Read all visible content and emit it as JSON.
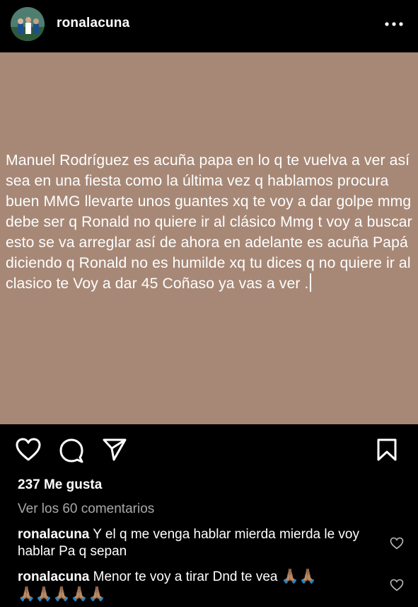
{
  "header": {
    "username": "ronalacuna",
    "more_icon": "ellipsis-icon"
  },
  "post": {
    "background_color": "#a78876",
    "text": "Manuel Rodríguez es acuña papa en lo q te vuelva a ver así sea en una fiesta como la última vez q hablamos procura buen MMG llevarte unos guantes xq te voy a dar golpe mmg debe ser q Ronald no quiere ir al clásico Mmg t voy a buscar esto se va arreglar así de ahora en adelante es acuña Papá diciendo q Ronald no es humilde xq tu dices q no quiere ir al clasico te Voy a dar 45 Coñaso ya vas a ver ."
  },
  "actions": {
    "like_icon": "heart-icon",
    "comment_icon": "comment-icon",
    "share_icon": "send-icon",
    "save_icon": "bookmark-icon"
  },
  "likes": "237 Me gusta",
  "view_comments": "Ver los 60 comentarios",
  "comments": [
    {
      "user": "ronalacuna",
      "text": " Y el q me venga hablar mierda mierda le voy hablar Pa q sepan"
    },
    {
      "user": "ronalacuna",
      "text": " Menor te voy a tirar Dnd te vea ",
      "emoji": "🙏🏽🙏🏽",
      "emoji_line2": "🙏🏽🙏🏽🙏🏽🙏🏽🙏🏽"
    }
  ]
}
